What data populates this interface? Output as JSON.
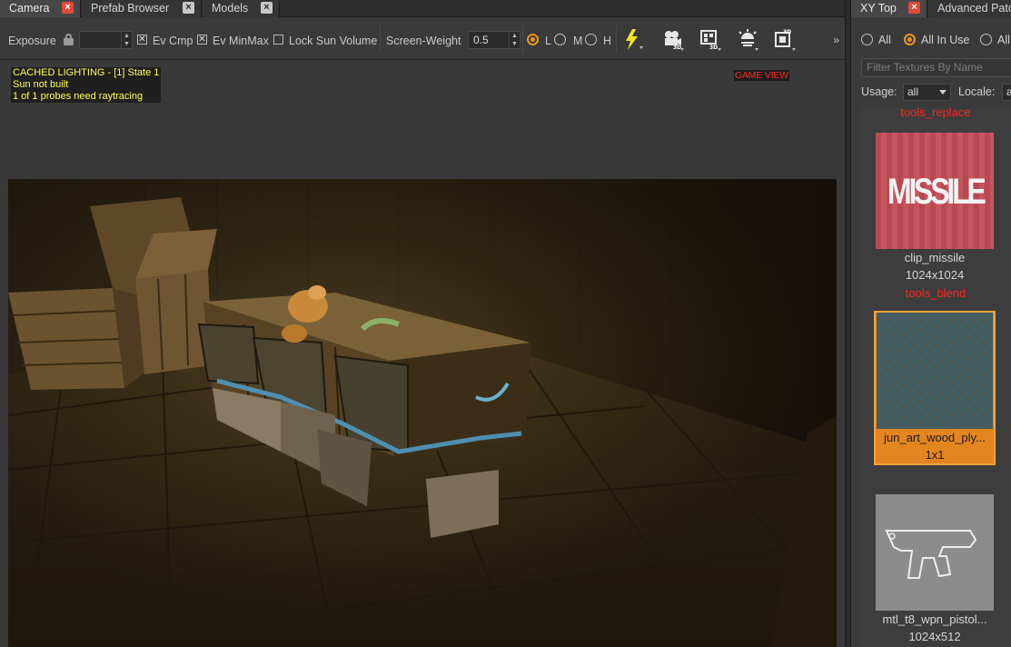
{
  "left_tabs": [
    {
      "label": "Camera",
      "active": true
    },
    {
      "label": "Prefab Browser",
      "active": false
    },
    {
      "label": "Models",
      "active": false
    }
  ],
  "toolbar": {
    "exposure_label": "Exposure",
    "exposure_value": "",
    "ev_cmp_label": "Ev Cmp",
    "ev_cmp_checked": true,
    "ev_minmax_label": "Ev MinMax",
    "ev_minmax_checked": true,
    "lock_sun_label": "Lock Sun Volume",
    "lock_sun_checked": false,
    "screen_weight_label": "Screen-Weight",
    "screen_weight_value": "0.5",
    "lod_options": [
      "L",
      "M",
      "H"
    ],
    "lod_selected": "L",
    "more_label": "»",
    "icons": [
      "lightning-icon",
      "camera-3d-icon",
      "film-3d-icon",
      "sun-light-icon",
      "box-3d-icon"
    ],
    "accent": "#e8961e"
  },
  "viewport": {
    "overlay_lines": [
      "CACHED LIGHTING - [1] State 1",
      "Sun not built",
      "1 of 1 probes need raytracing"
    ],
    "game_view_label": "GAME VIEW"
  },
  "right_tabs": [
    {
      "label": "XY Top",
      "active": true
    },
    {
      "label": "Advanced Patc",
      "active": false
    }
  ],
  "texture_browser": {
    "filter_options": [
      "All",
      "All In Use",
      "All"
    ],
    "filter_selected": "All In Use",
    "search_placeholder": "Filter Textures By Name",
    "usage_label": "Usage:",
    "usage_value": "all",
    "locale_label": "Locale:",
    "locale_value": "a",
    "groups": [
      {
        "name": "tools_replace"
      },
      {
        "name": "tools_blend"
      }
    ],
    "items": [
      {
        "name": "clip_missile",
        "size": "1024x1024",
        "selected": false,
        "thumb_text": "MISSILE"
      },
      {
        "name": "jun_art_wood_ply...",
        "size": "1x1",
        "selected": true
      },
      {
        "name": "mtl_t8_wpn_pistol...",
        "size": "1024x512",
        "selected": false
      }
    ]
  }
}
